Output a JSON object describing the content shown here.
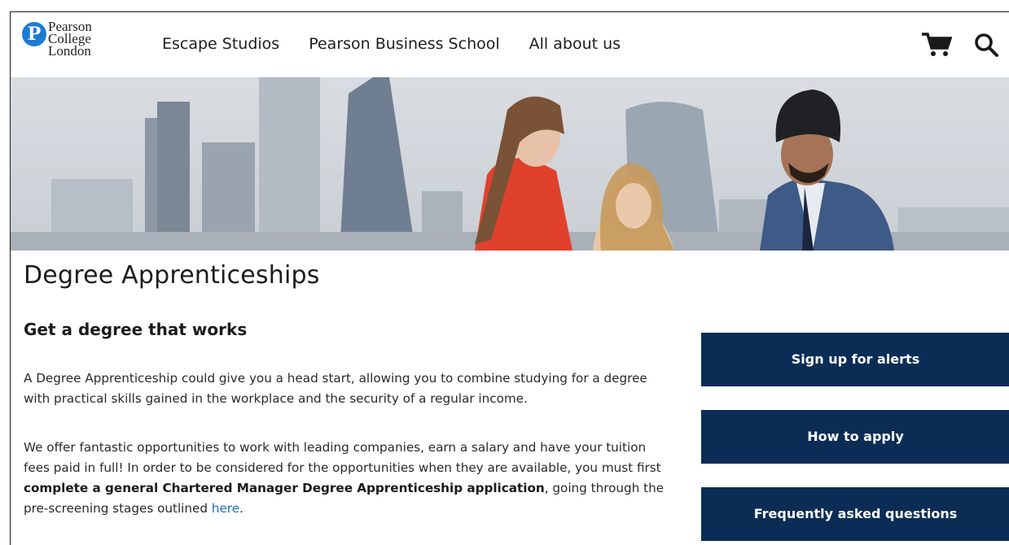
{
  "header": {
    "logo_lines": [
      "Pearson",
      "College",
      "London"
    ],
    "logo_letter": "P",
    "nav": [
      {
        "label": "Escape Studios"
      },
      {
        "label": "Pearson Business School"
      },
      {
        "label": "All about us"
      }
    ],
    "icons": [
      "cart-icon",
      "search-icon"
    ]
  },
  "main": {
    "title": "Degree Apprenticeships",
    "subheading": "Get a degree that works",
    "paragraph1": "A Degree Apprenticeship could give you a head start, allowing you to combine studying for a degree with practical skills gained in the workplace and the security of a regular income.",
    "paragraph2_start": "We offer fantastic opportunities to work with leading companies, earn a salary and have your tuition fees paid in full! In order to be considered for the opportunities when they are available, you must first ",
    "paragraph2_bold": "complete a general Chartered Manager Degree Apprenticeship application",
    "paragraph2_mid": ", going through the pre-screening stages outlined ",
    "paragraph2_link": "here",
    "paragraph2_end": "."
  },
  "sidebar": {
    "buttons": [
      {
        "label": "Sign up for alerts"
      },
      {
        "label": "How to apply"
      },
      {
        "label": "Frequently asked questions"
      }
    ]
  },
  "colors": {
    "button_bg": "#0b2d55",
    "logo_blue": "#1d7bd1",
    "link": "#1d6db3"
  }
}
